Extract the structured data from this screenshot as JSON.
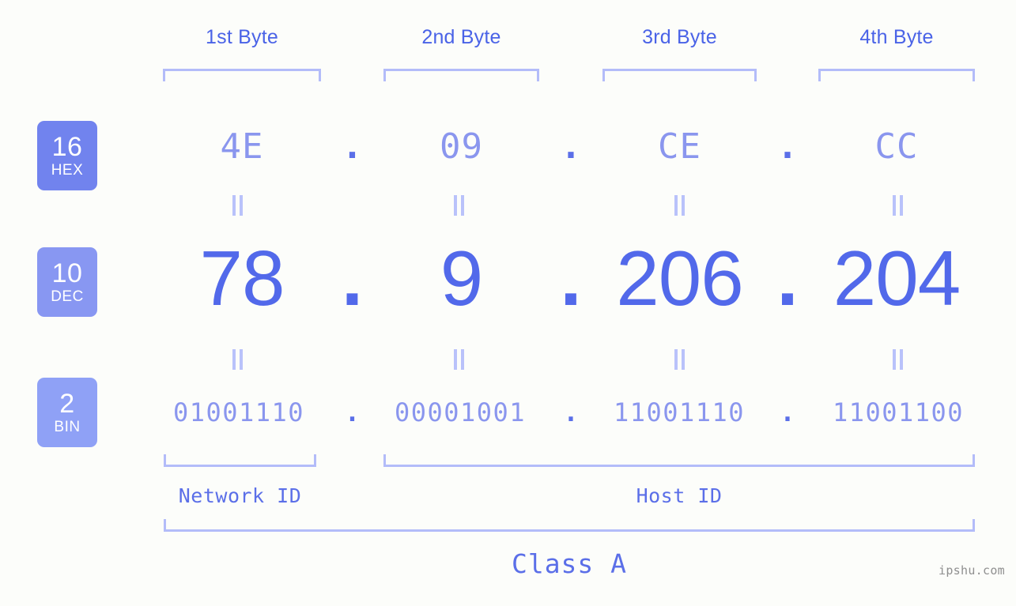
{
  "page": {
    "background": "#fcfdfa",
    "accent_strong": "#5269ea",
    "accent_light": "#8a96ee",
    "bracket_color": "#b3bcf9",
    "watermark": "ipshu.com"
  },
  "byte_headers": [
    {
      "label": "1st Byte"
    },
    {
      "label": "2nd Byte"
    },
    {
      "label": "3rd Byte"
    },
    {
      "label": "4th Byte"
    }
  ],
  "rows": {
    "hex": {
      "badge": {
        "number": "16",
        "name": "HEX",
        "color": "#7183ee"
      },
      "values": [
        "4E",
        "09",
        "CE",
        "CC"
      ],
      "separator": "."
    },
    "dec": {
      "badge": {
        "number": "10",
        "name": "DEC",
        "color": "#8897f2"
      },
      "values": [
        "78",
        "9",
        "206",
        "204"
      ],
      "separator": "."
    },
    "bin": {
      "badge": {
        "number": "2",
        "name": "BIN",
        "color": "#8fa1f6"
      },
      "values": [
        "01001110",
        "00001001",
        "11001110",
        "11001100"
      ],
      "separator": "."
    }
  },
  "segments": {
    "network_id": "Network ID",
    "host_id": "Host ID",
    "class": "Class A"
  }
}
